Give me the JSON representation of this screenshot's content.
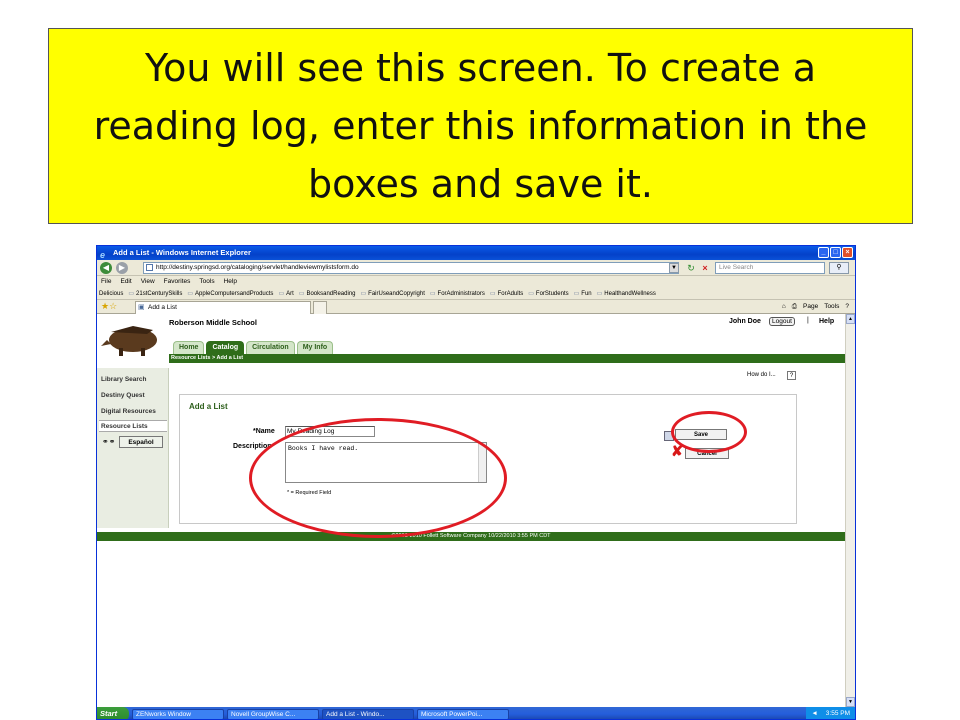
{
  "caption": "You will see this screen.  To create a reading log, enter this information in the boxes and save it.",
  "browser": {
    "window_title": "Add a List - Windows Internet Explorer",
    "window_buttons": [
      "_",
      "□",
      "×"
    ],
    "address": "http://destiny.springsd.org/cataloging/servlet/handleviewmylistsform.do",
    "live_search_placeholder": "Live Search",
    "menu": [
      "File",
      "Edit",
      "View",
      "Favorites",
      "Tools",
      "Help"
    ],
    "favorites": [
      "Delicious",
      "21stCenturySkills",
      "AppleComputersandProducts",
      "Art",
      "BooksandReading",
      "FairUseandCopyright",
      "ForAdministrators",
      "ForAdults",
      "ForStudents",
      "Fun",
      "HealthandWellness"
    ],
    "tab_label": "Add a List",
    "command_bar": [
      "Page",
      "Tools"
    ]
  },
  "site": {
    "school": "Roberson Middle School",
    "user": "John Doe",
    "logout": "Logout",
    "separator": "|",
    "help": "Help",
    "tabs": [
      "Home",
      "Catalog",
      "Circulation",
      "My Info"
    ],
    "active_tab": "Catalog",
    "breadcrumb": "Resource Lists > Add a List",
    "sidebar": [
      "Library Search",
      "Destiny Quest",
      "Digital Resources",
      "Resource Lists"
    ],
    "language_button": "Español",
    "how_do_i": "How do I...",
    "how_do_i_icon": "?",
    "footer": "©2002-2010  Follett Software Company     10/22/2010 3:55 PM CDT"
  },
  "form": {
    "title": "Add a List",
    "name_label": "*Name",
    "name_value": "My Reading Log",
    "description_label": "Description",
    "description_value": "Books I have read.",
    "required_note": "* = Required Field",
    "save_label": "Save",
    "cancel_label": "Cancel"
  },
  "taskbar": {
    "start": "Start",
    "tasks": [
      "ZENworks Window",
      "Novell GroupWise C...",
      "Add a List - Windo...",
      "Microsoft PowerPoi..."
    ],
    "clock": "3:55 PM"
  },
  "colors": {
    "caption_bg": "#ffff00",
    "site_green": "#2f6d1a",
    "highlight_ring": "#e01c24"
  }
}
